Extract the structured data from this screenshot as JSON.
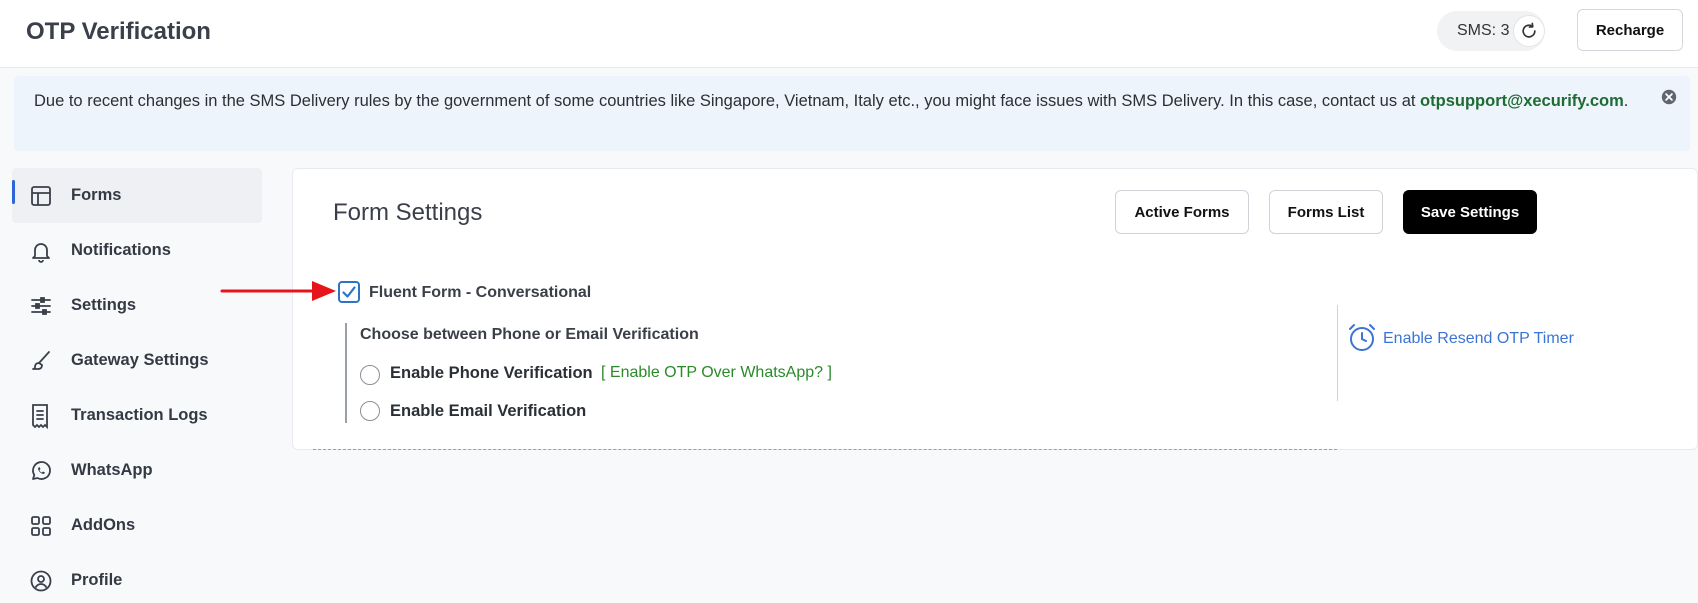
{
  "header": {
    "title": "OTP Verification",
    "sms_label": "SMS: 3",
    "refresh_icon": "refresh-icon",
    "recharge_label": "Recharge"
  },
  "notice": {
    "text": "Due to recent changes in the SMS Delivery rules by the government of some countries like Singapore, Vietnam, Italy etc., you might face issues with SMS Delivery. In this case, contact us at ",
    "email": "otpsupport@xecurify.com",
    "suffix": ".",
    "close_icon": "close-circle-icon"
  },
  "sidebar": {
    "items": [
      {
        "label": "Forms",
        "icon": "forms-icon",
        "active": true
      },
      {
        "label": "Notifications",
        "icon": "bell-icon"
      },
      {
        "label": "Settings",
        "icon": "sliders-icon"
      },
      {
        "label": "Gateway Settings",
        "icon": "brush-icon"
      },
      {
        "label": "Transaction Logs",
        "icon": "logs-icon"
      },
      {
        "label": "WhatsApp",
        "icon": "whatsapp-icon"
      },
      {
        "label": "AddOns",
        "icon": "grid-icon"
      },
      {
        "label": "Profile",
        "icon": "user-icon"
      }
    ]
  },
  "panel": {
    "title": "Form Settings",
    "buttons": {
      "active_forms": "Active Forms",
      "forms_list": "Forms List",
      "save_settings": "Save Settings"
    },
    "form_name": "Fluent Form - Conversational",
    "form_checked": true,
    "choose_label": "Choose between Phone or Email Verification",
    "phone_label": "Enable Phone Verification",
    "whatsapp_link": "[ Enable OTP Over WhatsApp? ]",
    "email_label": "Enable Email Verification",
    "timer_link": "Enable Resend OTP Timer"
  },
  "colors": {
    "accent_blue": "#2d66d8",
    "arrow_red": "#e8141c",
    "link_green": "#2a8a2a",
    "primary_button": "#000000"
  }
}
